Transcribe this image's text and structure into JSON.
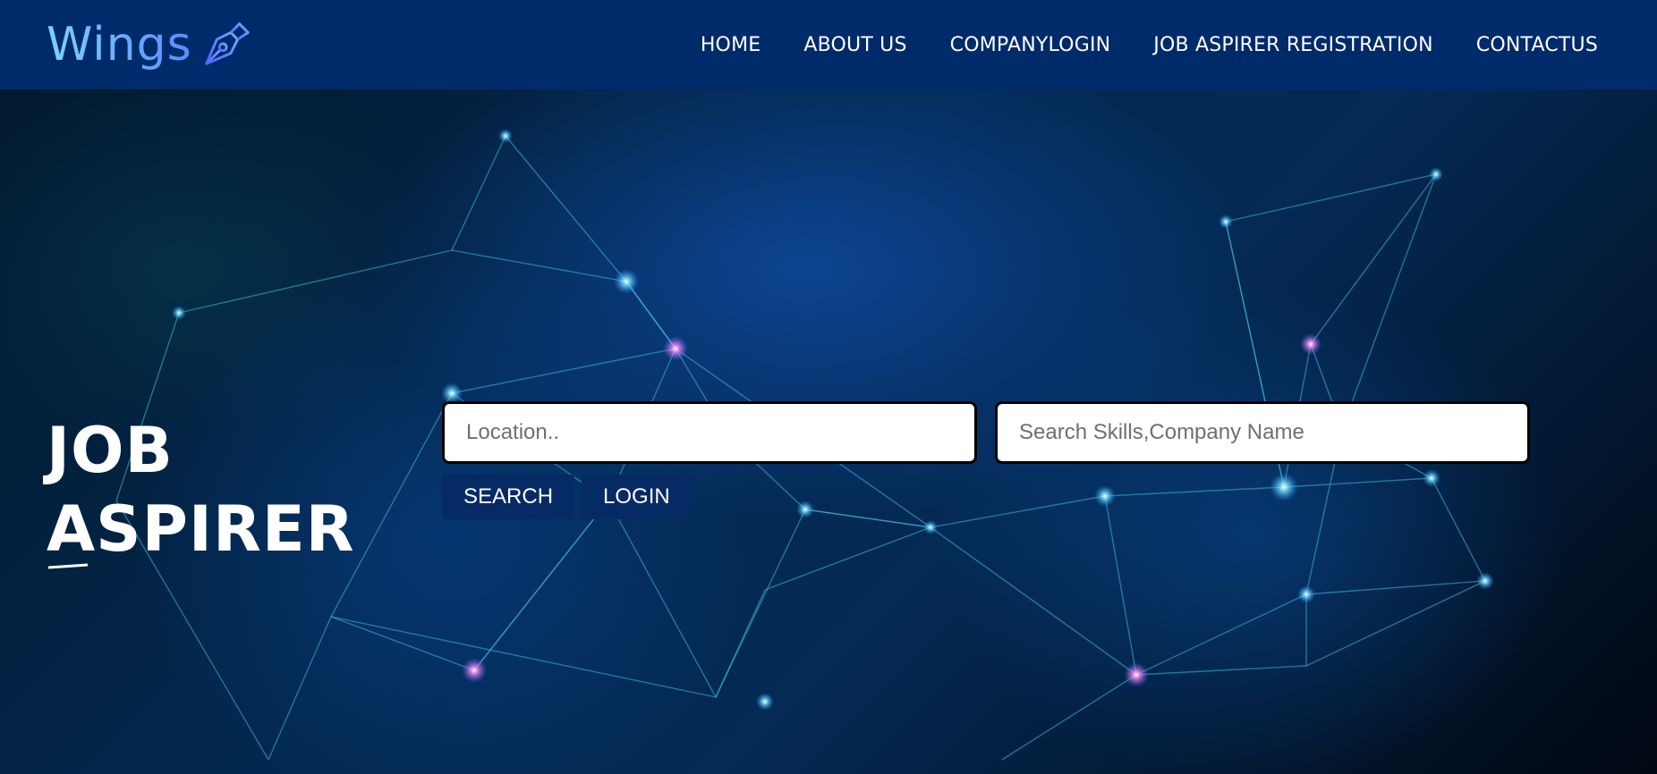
{
  "brand": {
    "name": "Wings",
    "icon": "pen-nib-icon"
  },
  "nav": {
    "items": [
      {
        "label": "HOME"
      },
      {
        "label": "ABOUT US"
      },
      {
        "label": "COMPANYLOGIN"
      },
      {
        "label": "JOB ASPIRER REGISTRATION"
      },
      {
        "label": "CONTACTUS"
      }
    ]
  },
  "hero": {
    "title_line1": "JOB",
    "title_line2": "ASPIRER"
  },
  "search": {
    "location_placeholder": "Location..",
    "skills_placeholder": "Search Skills,Company Name",
    "search_label": "SEARCH",
    "login_label": "LOGIN"
  },
  "colors": {
    "navbar": "#002b6a",
    "button": "#062a64",
    "brand_gradient_start": "#7fd0ff",
    "brand_gradient_end": "#5a8cff"
  }
}
